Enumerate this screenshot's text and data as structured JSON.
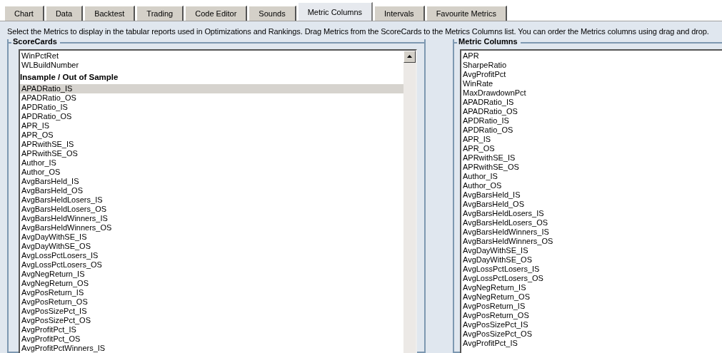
{
  "tabs": [
    {
      "label": "Chart",
      "selected": false
    },
    {
      "label": "Data",
      "selected": false
    },
    {
      "label": "Backtest",
      "selected": false
    },
    {
      "label": "Trading",
      "selected": false
    },
    {
      "label": "Code Editor",
      "selected": false
    },
    {
      "label": "Sounds",
      "selected": false
    },
    {
      "label": "Metric Columns",
      "selected": true
    },
    {
      "label": "Intervals",
      "selected": false
    },
    {
      "label": "Favourite Metrics",
      "selected": false
    }
  ],
  "instructions": "Select the Metrics to display in the tabular reports used in Optimizations and Rankings. Drag Metrics from the ScoreCards to the Metrics Columns list. You can order the Metrics columns using drag and drop.",
  "scorecards": {
    "title": "ScoreCards",
    "items": [
      {
        "kind": "item",
        "label": "WinPctRet",
        "selected": false
      },
      {
        "kind": "item",
        "label": "WLBuildNumber",
        "selected": false
      },
      {
        "kind": "group",
        "label": "Insample / Out of Sample"
      },
      {
        "kind": "item",
        "label": "APADRatio_IS",
        "selected": true
      },
      {
        "kind": "item",
        "label": "APADRatio_OS",
        "selected": false
      },
      {
        "kind": "item",
        "label": "APDRatio_IS",
        "selected": false
      },
      {
        "kind": "item",
        "label": "APDRatio_OS",
        "selected": false
      },
      {
        "kind": "item",
        "label": "APR_IS",
        "selected": false
      },
      {
        "kind": "item",
        "label": "APR_OS",
        "selected": false
      },
      {
        "kind": "item",
        "label": "APRwithSE_IS",
        "selected": false
      },
      {
        "kind": "item",
        "label": "APRwithSE_OS",
        "selected": false
      },
      {
        "kind": "item",
        "label": "Author_IS",
        "selected": false
      },
      {
        "kind": "item",
        "label": "Author_OS",
        "selected": false
      },
      {
        "kind": "item",
        "label": "AvgBarsHeld_IS",
        "selected": false
      },
      {
        "kind": "item",
        "label": "AvgBarsHeld_OS",
        "selected": false
      },
      {
        "kind": "item",
        "label": "AvgBarsHeldLosers_IS",
        "selected": false
      },
      {
        "kind": "item",
        "label": "AvgBarsHeldLosers_OS",
        "selected": false
      },
      {
        "kind": "item",
        "label": "AvgBarsHeldWinners_IS",
        "selected": false
      },
      {
        "kind": "item",
        "label": "AvgBarsHeldWinners_OS",
        "selected": false
      },
      {
        "kind": "item",
        "label": "AvgDayWithSE_IS",
        "selected": false
      },
      {
        "kind": "item",
        "label": "AvgDayWithSE_OS",
        "selected": false
      },
      {
        "kind": "item",
        "label": "AvgLossPctLosers_IS",
        "selected": false
      },
      {
        "kind": "item",
        "label": "AvgLossPctLosers_OS",
        "selected": false
      },
      {
        "kind": "item",
        "label": "AvgNegReturn_IS",
        "selected": false
      },
      {
        "kind": "item",
        "label": "AvgNegReturn_OS",
        "selected": false
      },
      {
        "kind": "item",
        "label": "AvgPosReturn_IS",
        "selected": false
      },
      {
        "kind": "item",
        "label": "AvgPosReturn_OS",
        "selected": false
      },
      {
        "kind": "item",
        "label": "AvgPosSizePct_IS",
        "selected": false
      },
      {
        "kind": "item",
        "label": "AvgPosSizePct_OS",
        "selected": false
      },
      {
        "kind": "item",
        "label": "AvgProfitPct_IS",
        "selected": false
      },
      {
        "kind": "item",
        "label": "AvgProfitPct_OS",
        "selected": false
      },
      {
        "kind": "item",
        "label": "AvgProfitPctWinners_IS",
        "selected": false
      }
    ]
  },
  "metric_columns": {
    "title": "Metric Columns",
    "items": [
      "APR",
      "SharpeRatio",
      "AvgProfitPct",
      "WinRate",
      "MaxDrawdownPct",
      "APADRatio_IS",
      "APADRatio_OS",
      "APDRatio_IS",
      "APDRatio_OS",
      "APR_IS",
      "APR_OS",
      "APRwithSE_IS",
      "APRwithSE_OS",
      "Author_IS",
      "Author_OS",
      "AvgBarsHeld_IS",
      "AvgBarsHeld_OS",
      "AvgBarsHeldLosers_IS",
      "AvgBarsHeldLosers_OS",
      "AvgBarsHeldWinners_IS",
      "AvgBarsHeldWinners_OS",
      "AvgDayWithSE_IS",
      "AvgDayWithSE_OS",
      "AvgLossPctLosers_IS",
      "AvgLossPctLosers_OS",
      "AvgNegReturn_IS",
      "AvgNegReturn_OS",
      "AvgPosReturn_IS",
      "AvgPosReturn_OS",
      "AvgPosSizePct_IS",
      "AvgPosSizePct_OS",
      "AvgProfitPct_IS"
    ]
  }
}
